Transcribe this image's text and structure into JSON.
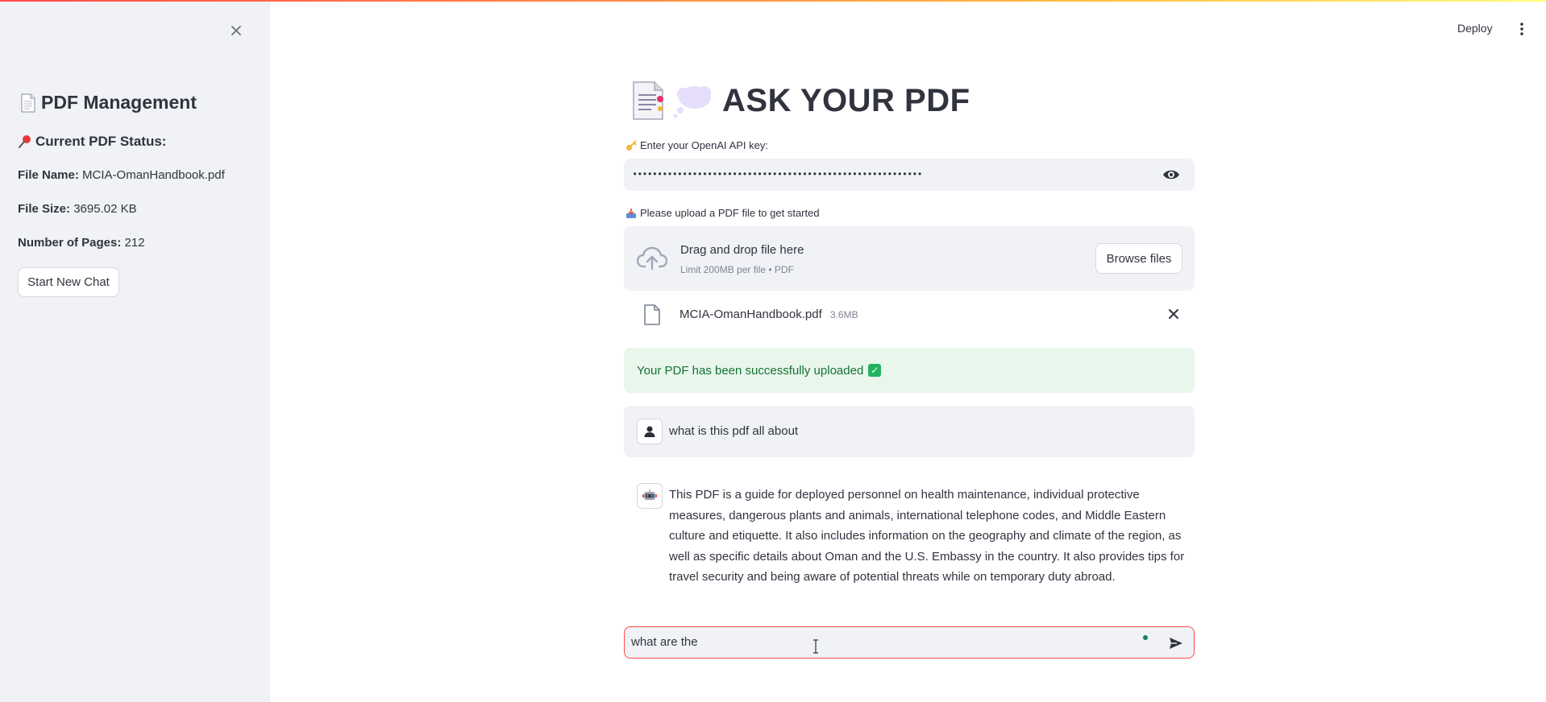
{
  "colors": {
    "accent": "#ff4b4b",
    "sidebar_bg": "#f0f2f6",
    "success_bg": "#e8f6ec",
    "success_text": "#177233"
  },
  "header": {
    "deploy_label": "Deploy"
  },
  "sidebar": {
    "title": "PDF Management",
    "title_icon": "page-icon",
    "status_heading": "Current PDF Status:",
    "status_icon": "pushpin-icon",
    "file_name_label": "File Name:",
    "file_name_value": "MCIA-OmanHandbook.pdf",
    "file_size_label": "File Size:",
    "file_size_value": "3695.02 KB",
    "pages_label": "Number of Pages:",
    "pages_value": "212",
    "new_chat_label": "Start New Chat"
  },
  "main": {
    "title": "ASK YOUR PDF",
    "api_key_label": "Enter your OpenAI API key:",
    "api_key_value": "••••••••••••••••••••••••••••••••••••••••••••••••••••••••••",
    "upload_label": "Please upload a PDF file to get started",
    "dropzone_title": "Drag and drop file here",
    "dropzone_limit": "Limit 200MB per file • PDF",
    "browse_label": "Browse files",
    "uploaded_file_name": "MCIA-OmanHandbook.pdf",
    "uploaded_file_size": "3.6MB",
    "success_message": "Your PDF has been successfully uploaded",
    "messages": [
      {
        "role": "user",
        "text": "what is this pdf all about"
      },
      {
        "role": "assistant",
        "text": "This PDF is a guide for deployed personnel on health maintenance, individual protective measures, dangerous plants and animals, international telephone codes, and Middle Eastern culture and etiquette. It also includes information on the geography and climate of the region, as well as specific details about Oman and the U.S. Embassy in the country. It also provides tips for travel security and being aware of potential threats while on temporary duty abroad."
      }
    ],
    "chat_input_value": "what are the"
  }
}
